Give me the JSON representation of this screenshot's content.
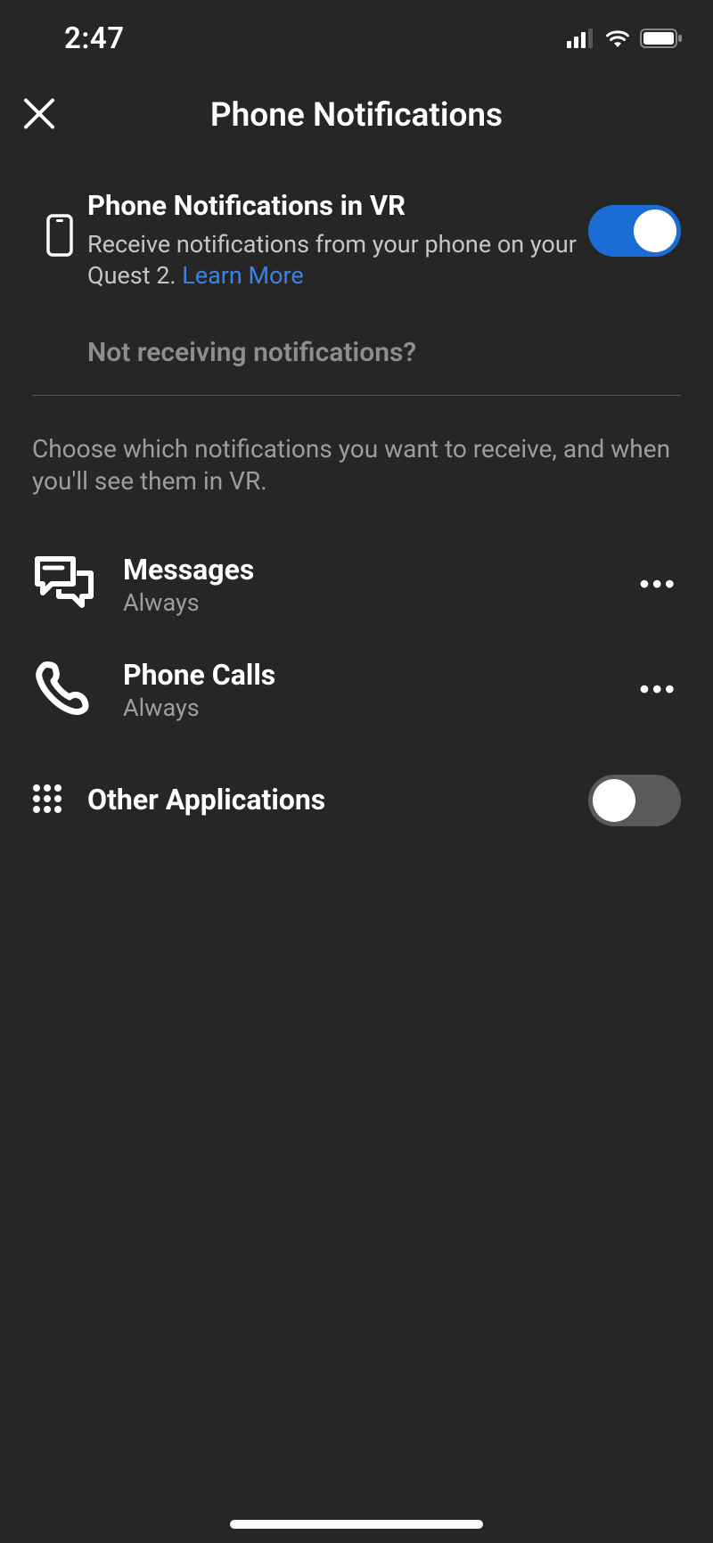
{
  "status": {
    "time": "2:47"
  },
  "header": {
    "title": "Phone Notifications"
  },
  "mainToggle": {
    "title": "Phone Notifications in VR",
    "desc_before": "Receive notifications from your phone on your Quest 2. ",
    "learn_more": "Learn More",
    "enabled": true
  },
  "help_link": "Not receiving notifications?",
  "choose_text": "Choose which notifications you want to receive, and when you'll see them in VR.",
  "items": [
    {
      "title": "Messages",
      "subtitle": "Always"
    },
    {
      "title": "Phone Calls",
      "subtitle": "Always"
    }
  ],
  "other": {
    "title": "Other Applications",
    "enabled": false
  }
}
